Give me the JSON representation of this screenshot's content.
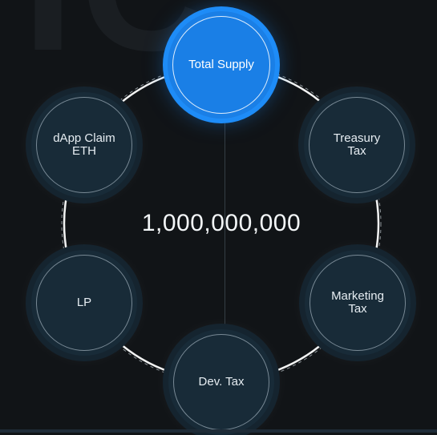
{
  "total_value": "1,000,000,000",
  "nodes": [
    {
      "id": "total-supply",
      "label": "Total Supply",
      "active": true
    },
    {
      "id": "treasury-tax",
      "label": "Treasury\nTax",
      "active": false
    },
    {
      "id": "marketing-tax",
      "label": "Marketing\nTax",
      "active": false
    },
    {
      "id": "dev-tax",
      "label": "Dev. Tax",
      "active": false
    },
    {
      "id": "lp",
      "label": "LP",
      "active": false
    },
    {
      "id": "dapp-claim-eth",
      "label": "dApp Claim\nETH",
      "active": false
    }
  ],
  "colors": {
    "accent": "#1e8cf7",
    "node_fill": "#182b38",
    "background": "#111417"
  }
}
